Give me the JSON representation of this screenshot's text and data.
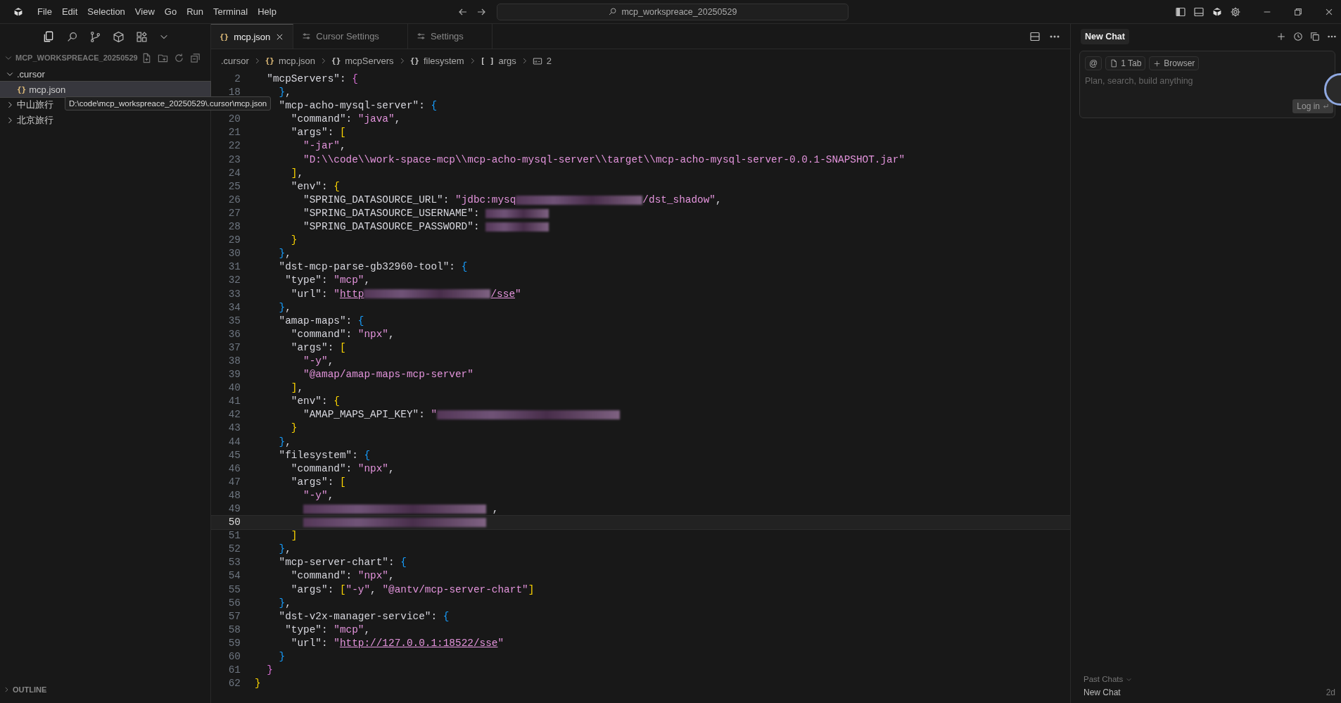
{
  "menu": [
    "File",
    "Edit",
    "Selection",
    "View",
    "Go",
    "Run",
    "Terminal",
    "Help"
  ],
  "command_center": {
    "value": "mcp_workspreace_20250529"
  },
  "sidebar": {
    "header": "MCP_WORKSPREACE_20250529",
    "tree": [
      {
        "label": ".cursor",
        "kind": "folder",
        "expanded": true,
        "selected": false,
        "children": [
          {
            "label": "mcp.json",
            "kind": "json",
            "icon": "{}",
            "selected": true
          }
        ]
      },
      {
        "label": "中山旅行",
        "kind": "folder",
        "expanded": false,
        "selected": false
      },
      {
        "label": "北京旅行",
        "kind": "folder",
        "expanded": false,
        "selected": false
      }
    ],
    "tooltip": "D:\\code\\mcp_workspreace_20250529\\.cursor\\mcp.json",
    "sections": [
      {
        "label": "OUTLINE",
        "expanded": false
      }
    ]
  },
  "tabs": [
    {
      "label": "mcp.json",
      "kind": "json",
      "icon": "{}",
      "selected": true
    },
    {
      "label": "Cursor Settings",
      "kind": "settings",
      "selected": false
    },
    {
      "label": "Settings",
      "kind": "settings",
      "selected": false
    }
  ],
  "breadcrumbs": [
    {
      "label": ".cursor",
      "kind": "folder"
    },
    {
      "label": "mcp.json",
      "kind": "json",
      "icon": "{}"
    },
    {
      "label": "mcpServers",
      "kind": "object",
      "icon": "{}"
    },
    {
      "label": "filesystem",
      "kind": "object",
      "icon": "{}"
    },
    {
      "label": "args",
      "kind": "array",
      "icon": "[ ]"
    },
    {
      "label": "2",
      "kind": "string"
    }
  ],
  "editor": {
    "lines": [
      {
        "number": "2",
        "current": false,
        "tokens": [
          {
            "kind": "key",
            "text": "  \"mcpServers\""
          },
          {
            "kind": "punct",
            "text": ": "
          },
          {
            "kind": "bracket",
            "text": "{",
            "color": "#da70d6"
          }
        ]
      },
      {
        "number": "18",
        "current": false,
        "tokens": [
          {
            "kind": "bracket",
            "text": "    }",
            "color": "#179fff"
          },
          {
            "kind": "punct",
            "text": ","
          }
        ]
      },
      {
        "current": false,
        "tokens": [
          {
            "kind": "key",
            "text": "    \"mcp-acho-mysql-server\""
          },
          {
            "kind": "punct",
            "text": ": "
          },
          {
            "kind": "bracket",
            "text": "{",
            "color": "#179fff"
          }
        ]
      },
      {
        "number": "20",
        "current": false,
        "tokens": [
          {
            "kind": "key",
            "text": "      \"command\""
          },
          {
            "kind": "punct",
            "text": ": "
          },
          {
            "kind": "string",
            "text": "\"java\""
          },
          {
            "kind": "punct",
            "text": ","
          }
        ]
      },
      {
        "number": "21",
        "current": false,
        "tokens": [
          {
            "kind": "key",
            "text": "      \"args\""
          },
          {
            "kind": "punct",
            "text": ": "
          },
          {
            "kind": "bracket",
            "text": "[",
            "color": "#ffd700"
          }
        ]
      },
      {
        "number": "22",
        "current": false,
        "tokens": [
          {
            "kind": "string",
            "text": "        \"-jar\""
          },
          {
            "kind": "punct",
            "text": ","
          }
        ]
      },
      {
        "number": "23",
        "current": false,
        "tokens": [
          {
            "kind": "string",
            "text": "        \"D:\\\\code\\\\work-space-mcp\\\\mcp-acho-mysql-server\\\\target\\\\mcp-acho-mysql-server-0.0.1-SNAPSHOT.jar\""
          }
        ]
      },
      {
        "number": "24",
        "current": false,
        "tokens": [
          {
            "kind": "bracket",
            "text": "      ]",
            "color": "#ffd700"
          },
          {
            "kind": "punct",
            "text": ","
          }
        ]
      },
      {
        "number": "25",
        "current": false,
        "tokens": [
          {
            "kind": "key",
            "text": "      \"env\""
          },
          {
            "kind": "punct",
            "text": ": "
          },
          {
            "kind": "bracket",
            "text": "{",
            "color": "#ffd700"
          }
        ]
      },
      {
        "number": "26",
        "current": false,
        "tokens": [
          {
            "kind": "key",
            "text": "        \"SPRING_DATASOURCE_URL\""
          },
          {
            "kind": "punct",
            "text": ": "
          },
          {
            "kind": "string",
            "text": "\"jdbc:mysq"
          },
          {
            "kind": "blur-medium"
          },
          {
            "kind": "string",
            "text": "/dst_shadow\""
          },
          {
            "kind": "punct",
            "text": ","
          }
        ]
      },
      {
        "number": "27",
        "current": false,
        "tokens": [
          {
            "kind": "key",
            "text": "        \"SPRING_DATASOURCE_USERNAME\""
          },
          {
            "kind": "punct",
            "text": ": "
          },
          {
            "kind": "blur-short"
          }
        ]
      },
      {
        "number": "28",
        "current": false,
        "tokens": [
          {
            "kind": "key",
            "text": "        \"SPRING_DATASOURCE_PASSWORD\""
          },
          {
            "kind": "punct",
            "text": ": "
          },
          {
            "kind": "blur-short"
          }
        ]
      },
      {
        "number": "29",
        "current": false,
        "tokens": [
          {
            "kind": "bracket",
            "text": "      }",
            "color": "#ffd700"
          }
        ]
      },
      {
        "number": "30",
        "current": false,
        "tokens": [
          {
            "kind": "bracket",
            "text": "    }",
            "color": "#179fff"
          },
          {
            "kind": "punct",
            "text": ","
          }
        ]
      },
      {
        "number": "31",
        "current": false,
        "tokens": [
          {
            "kind": "key",
            "text": "    \"dst-mcp-parse-gb32960-tool\""
          },
          {
            "kind": "punct",
            "text": ": "
          },
          {
            "kind": "bracket",
            "text": "{",
            "color": "#179fff"
          }
        ]
      },
      {
        "number": "32",
        "current": false,
        "tokens": [
          {
            "kind": "key",
            "text": "     \"type\""
          },
          {
            "kind": "punct",
            "text": ": "
          },
          {
            "kind": "string",
            "text": "\"mcp\""
          },
          {
            "kind": "punct",
            "text": ","
          }
        ]
      },
      {
        "number": "33",
        "current": false,
        "tokens": [
          {
            "kind": "key",
            "text": "      \"url\""
          },
          {
            "kind": "punct",
            "text": ": "
          },
          {
            "kind": "string",
            "text": "\""
          },
          {
            "kind": "link",
            "text": "http"
          },
          {
            "kind": "blur-medium"
          },
          {
            "kind": "link",
            "text": "/sse"
          },
          {
            "kind": "string",
            "text": "\""
          }
        ]
      },
      {
        "number": "34",
        "current": false,
        "tokens": [
          {
            "kind": "bracket",
            "text": "    }",
            "color": "#179fff"
          },
          {
            "kind": "punct",
            "text": ","
          }
        ]
      },
      {
        "number": "35",
        "current": false,
        "tokens": [
          {
            "kind": "key",
            "text": "    \"amap-maps\""
          },
          {
            "kind": "punct",
            "text": ": "
          },
          {
            "kind": "bracket",
            "text": "{",
            "color": "#179fff"
          }
        ]
      },
      {
        "number": "36",
        "current": false,
        "tokens": [
          {
            "kind": "key",
            "text": "      \"command\""
          },
          {
            "kind": "punct",
            "text": ": "
          },
          {
            "kind": "string",
            "text": "\"npx\""
          },
          {
            "kind": "punct",
            "text": ","
          }
        ]
      },
      {
        "number": "37",
        "current": false,
        "tokens": [
          {
            "kind": "key",
            "text": "      \"args\""
          },
          {
            "kind": "punct",
            "text": ": "
          },
          {
            "kind": "bracket",
            "text": "[",
            "color": "#ffd700"
          }
        ]
      },
      {
        "number": "38",
        "current": false,
        "tokens": [
          {
            "kind": "string",
            "text": "        \"-y\""
          },
          {
            "kind": "punct",
            "text": ","
          }
        ]
      },
      {
        "number": "39",
        "current": false,
        "tokens": [
          {
            "kind": "string",
            "text": "        \"@amap/amap-maps-mcp-server\""
          }
        ]
      },
      {
        "number": "40",
        "current": false,
        "tokens": [
          {
            "kind": "bracket",
            "text": "      ]",
            "color": "#ffd700"
          },
          {
            "kind": "punct",
            "text": ","
          }
        ]
      },
      {
        "number": "41",
        "current": false,
        "tokens": [
          {
            "kind": "key",
            "text": "      \"env\""
          },
          {
            "kind": "punct",
            "text": ": "
          },
          {
            "kind": "bracket",
            "text": "{",
            "color": "#ffd700"
          }
        ]
      },
      {
        "number": "42",
        "current": false,
        "tokens": [
          {
            "kind": "key",
            "text": "        \"AMAP_MAPS_API_KEY\""
          },
          {
            "kind": "punct",
            "text": ": "
          },
          {
            "kind": "string",
            "text": "\""
          },
          {
            "kind": "blur-long"
          }
        ]
      },
      {
        "number": "43",
        "current": false,
        "tokens": [
          {
            "kind": "bracket",
            "text": "      }",
            "color": "#ffd700"
          }
        ]
      },
      {
        "number": "44",
        "current": false,
        "tokens": [
          {
            "kind": "bracket",
            "text": "    }",
            "color": "#179fff"
          },
          {
            "kind": "punct",
            "text": ","
          }
        ]
      },
      {
        "number": "45",
        "current": false,
        "tokens": [
          {
            "kind": "key",
            "text": "    \"filesystem\""
          },
          {
            "kind": "punct",
            "text": ": "
          },
          {
            "kind": "bracket",
            "text": "{",
            "color": "#179fff"
          }
        ]
      },
      {
        "number": "46",
        "current": false,
        "tokens": [
          {
            "kind": "key",
            "text": "      \"command\""
          },
          {
            "kind": "punct",
            "text": ": "
          },
          {
            "kind": "string",
            "text": "\"npx\""
          },
          {
            "kind": "punct",
            "text": ","
          }
        ]
      },
      {
        "number": "47",
        "current": false,
        "tokens": [
          {
            "kind": "key",
            "text": "      \"args\""
          },
          {
            "kind": "punct",
            "text": ": "
          },
          {
            "kind": "bracket",
            "text": "[",
            "color": "#ffd700"
          }
        ]
      },
      {
        "number": "48",
        "current": false,
        "tokens": [
          {
            "kind": "string",
            "text": "        \"-y\""
          },
          {
            "kind": "punct",
            "text": ","
          }
        ]
      },
      {
        "number": "49",
        "current": false,
        "tokens": [
          {
            "kind": "blur-long"
          },
          {
            "kind": "punct",
            "text": " ,"
          }
        ]
      },
      {
        "number": "50",
        "current": true,
        "tokens": [
          {
            "kind": "blur-long"
          }
        ]
      },
      {
        "number": "51",
        "current": false,
        "tokens": [
          {
            "kind": "bracket",
            "text": "      ]",
            "color": "#ffd700"
          }
        ]
      },
      {
        "number": "52",
        "current": false,
        "tokens": [
          {
            "kind": "bracket",
            "text": "    }",
            "color": "#179fff"
          },
          {
            "kind": "punct",
            "text": ","
          }
        ]
      },
      {
        "number": "53",
        "current": false,
        "tokens": [
          {
            "kind": "key",
            "text": "    \"mcp-server-chart\""
          },
          {
            "kind": "punct",
            "text": ": "
          },
          {
            "kind": "bracket",
            "text": "{",
            "color": "#179fff"
          }
        ]
      },
      {
        "number": "54",
        "current": false,
        "tokens": [
          {
            "kind": "key",
            "text": "      \"command\""
          },
          {
            "kind": "punct",
            "text": ": "
          },
          {
            "kind": "string",
            "text": "\"npx\""
          },
          {
            "kind": "punct",
            "text": ","
          }
        ]
      },
      {
        "number": "55",
        "current": false,
        "tokens": [
          {
            "kind": "key",
            "text": "      \"args\""
          },
          {
            "kind": "punct",
            "text": ": "
          },
          {
            "kind": "bracket",
            "text": "[",
            "color": "#ffd700"
          },
          {
            "kind": "string",
            "text": "\"-y\""
          },
          {
            "kind": "punct",
            "text": ", "
          },
          {
            "kind": "string",
            "text": "\"@antv/mcp-server-chart\""
          },
          {
            "kind": "bracket",
            "text": "]",
            "color": "#ffd700"
          }
        ]
      },
      {
        "number": "56",
        "current": false,
        "tokens": [
          {
            "kind": "bracket",
            "text": "    }",
            "color": "#179fff"
          },
          {
            "kind": "punct",
            "text": ","
          }
        ]
      },
      {
        "number": "57",
        "current": false,
        "tokens": [
          {
            "kind": "key",
            "text": "    \"dst-v2x-manager-service\""
          },
          {
            "kind": "punct",
            "text": ": "
          },
          {
            "kind": "bracket",
            "text": "{",
            "color": "#179fff"
          }
        ]
      },
      {
        "number": "58",
        "current": false,
        "tokens": [
          {
            "kind": "key",
            "text": "     \"type\""
          },
          {
            "kind": "punct",
            "text": ": "
          },
          {
            "kind": "string",
            "text": "\"mcp\""
          },
          {
            "kind": "punct",
            "text": ","
          }
        ]
      },
      {
        "number": "59",
        "current": false,
        "tokens": [
          {
            "kind": "key",
            "text": "      \"url\""
          },
          {
            "kind": "punct",
            "text": ": "
          },
          {
            "kind": "string",
            "text": "\""
          },
          {
            "kind": "link",
            "text": "http://127.0.0.1:18522/sse"
          },
          {
            "kind": "string",
            "text": "\""
          }
        ]
      },
      {
        "number": "60",
        "current": false,
        "tokens": [
          {
            "kind": "bracket",
            "text": "    }",
            "color": "#179fff"
          }
        ]
      },
      {
        "number": "61",
        "current": false,
        "tokens": [
          {
            "kind": "bracket",
            "text": "  }",
            "color": "#da70d6"
          }
        ]
      },
      {
        "number": "62",
        "current": false,
        "tokens": [
          {
            "kind": "bracket",
            "text": "}",
            "color": "#ffd700"
          }
        ]
      }
    ]
  },
  "chat": {
    "title": "New Chat",
    "chips": [
      {
        "label": "@",
        "kind": "mention"
      },
      {
        "label": "1 Tab",
        "kind": "tab"
      },
      {
        "label": "Browser",
        "kind": "add"
      }
    ],
    "placeholder": "Plan, search, build anything",
    "login": "Log in",
    "past_chats": "Past Chats",
    "history": [
      {
        "title": "New Chat",
        "age": "2d"
      }
    ]
  }
}
